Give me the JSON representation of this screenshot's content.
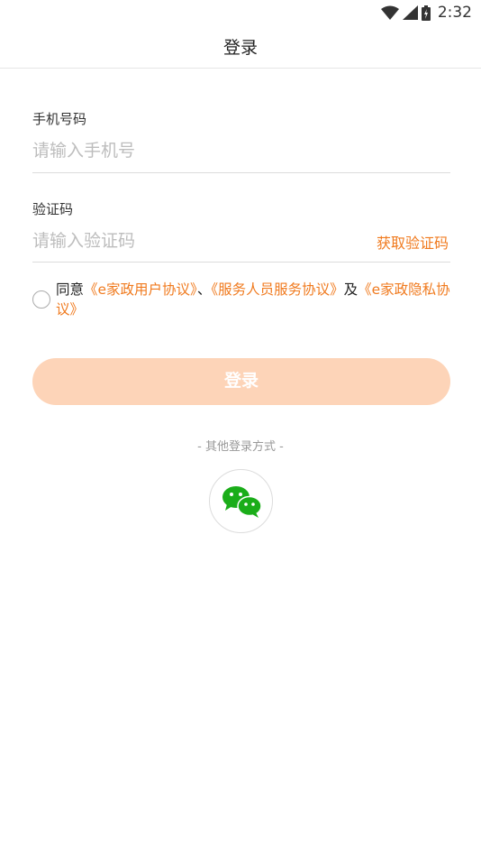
{
  "status_bar": {
    "time": "2:32"
  },
  "header": {
    "title": "登录"
  },
  "form": {
    "phone": {
      "label": "手机号码",
      "placeholder": "请输入手机号"
    },
    "code": {
      "label": "验证码",
      "placeholder": "请输入验证码",
      "get_code": "获取验证码"
    }
  },
  "agreement": {
    "prefix": "同意",
    "link1": "《e家政用户协议》",
    "sep": "、",
    "link2": "《服务人员服务协议》",
    "and": "及",
    "link3": "《e家政隐私协议》"
  },
  "login_button": {
    "label": "登录"
  },
  "other_login": {
    "label": "- 其他登录方式 -",
    "icon": "wechat-icon"
  },
  "colors": {
    "accent": "#f07a1e",
    "button_bg": "#fdd4b8",
    "wechat": "#1aad19"
  }
}
